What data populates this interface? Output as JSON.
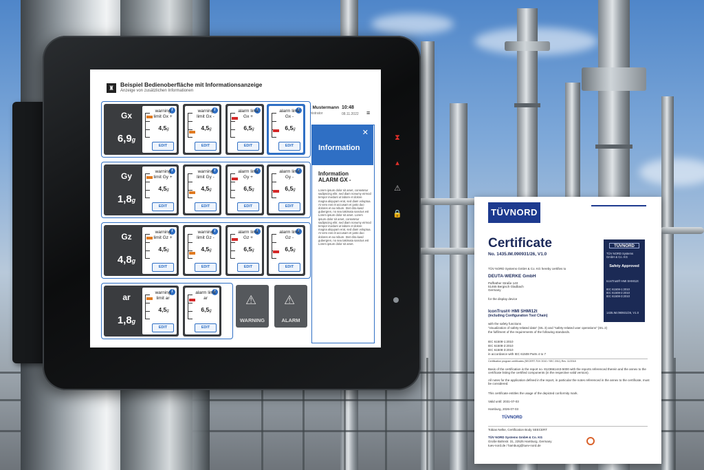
{
  "screen": {
    "header": {
      "logo_glyph": "♜",
      "title": "Beispiel Bedienoberfläche mit Informationsanzeige",
      "subtitle": "Anzeige von zusätzlichen Informationen",
      "user_name": "Max Mustermann",
      "user_role": "Administrator",
      "time": "10:48",
      "date": "08.11.2022",
      "menu_glyph": "≡",
      "user_glyph": "👤"
    },
    "rows": [
      {
        "axis": "Gx",
        "value": "6,9",
        "unit": "g",
        "tiles": [
          {
            "label": "warning limit Gx +",
            "value": "4,5",
            "unit": "g",
            "edit": "EDIT",
            "active": false
          },
          {
            "label": "warning limit Gx -",
            "value": "4,5",
            "unit": "g",
            "edit": "EDIT",
            "active": false
          },
          {
            "label": "alarm limit Gx +",
            "value": "6,5",
            "unit": "g",
            "edit": "EDIT",
            "active": false
          },
          {
            "label": "alarm limit Gx -",
            "value": "6,5",
            "unit": "g",
            "edit": "EDIT",
            "active": true
          }
        ]
      },
      {
        "axis": "Gy",
        "value": "1,8",
        "unit": "g",
        "tiles": [
          {
            "label": "warning limit Gy +",
            "value": "4,5",
            "unit": "g",
            "edit": "EDIT",
            "active": false
          },
          {
            "label": "warning limit Gy -",
            "value": "4,5",
            "unit": "g",
            "edit": "EDIT",
            "active": false
          },
          {
            "label": "alarm limit Gy +",
            "value": "6,5",
            "unit": "g",
            "edit": "EDIT",
            "active": false
          },
          {
            "label": "alarm limit Gy -",
            "value": "6,5",
            "unit": "g",
            "edit": "EDIT",
            "active": false
          }
        ]
      },
      {
        "axis": "Gz",
        "value": "4,8",
        "unit": "g",
        "tiles": [
          {
            "label": "warning limit Gz +",
            "value": "4,5",
            "unit": "g",
            "edit": "EDIT",
            "active": false
          },
          {
            "label": "warning limit Gz -",
            "value": "4,5",
            "unit": "g",
            "edit": "EDIT",
            "active": false
          },
          {
            "label": "alarm limit Gz +",
            "value": "6,5",
            "unit": "g",
            "edit": "EDIT",
            "active": false
          },
          {
            "label": "alarm limit Gz -",
            "value": "6,5",
            "unit": "g",
            "edit": "EDIT",
            "active": false
          }
        ]
      },
      {
        "axis": "ar",
        "value": "1,8",
        "unit": "g",
        "tiles": [
          {
            "label": "warning limit ar",
            "value": "4,5",
            "unit": "g",
            "edit": "EDIT",
            "active": false
          },
          {
            "label": "alarm limit ar",
            "value": "6,5",
            "unit": "g",
            "edit": "EDIT",
            "active": false
          }
        ]
      }
    ],
    "status": {
      "warning": "WARNING",
      "alarm": "ALARM",
      "glyph": "⚠"
    },
    "info_panel": {
      "title": "Information",
      "close_glyph": "✕",
      "subtitle_line1": "Information",
      "subtitle_line2": "ALARM GX -",
      "body": "Lorem ipsum dolor sit amet, consetetur sadipscing elitr, sed diam nonumy eirmod tempor invidunt ut labore et dolore magna aliquyam erat, sed diam voluptua. At vero eos et accusam et justo duo dolores et ea rebum. Stet clita kasd gubergren, no sea takimata sanctus est Lorem ipsum dolor sit amet. Lorem ipsum dolor sit amet, consetetur sadipscing elitr, sed diam nonumy eirmod tempor invidunt ut labore et dolore magna aliquyam erat, sed diam voluptua. At vero eos et accusam et justo duo dolores et ea rebum. Stet clita kasd gubergren, no sea takimata sanctus est Lorem ipsum dolor sit amet."
    }
  },
  "tablet_side_icons": [
    {
      "glyph": "⧗",
      "color": "#e0302a"
    },
    {
      "glyph": "▴",
      "color": "#e0302a"
    },
    {
      "glyph": "⚠",
      "color": "#bbbbbb"
    },
    {
      "glyph": "🔒",
      "color": "#f3c413"
    }
  ],
  "certificate": {
    "logo": "TÜVNORD",
    "title": "Certificate",
    "number": "No. 1435.IM.090931/26, V1.0",
    "intro": "TÜV NORD Systems GmbH & Co. KG hereby certifies to",
    "company": "DEUTA-WERKE GmbH",
    "address": [
      "Paffrather Straße 140",
      "51465 Bergisch Gladbach",
      "Germany"
    ],
    "for_device": "for the display device",
    "product": "IconTrust® HMI SHMI12t",
    "product_sub": "(including Configuration Tool Chain)",
    "functions_intro": "with the safety functions",
    "functions": "\"visualization of safety-related data\" (SIL 3) and \"safety-related user operations\" (SIL 2)",
    "fulfillment": "the fulfilment of the requirements of the following standards.",
    "standards": [
      "IEC 61508-1:2010",
      "IEC 61508-2:2010",
      "IEC 61508-3:2010",
      "in accordance with IEC 61508 Parts 4 to 7"
    ],
    "program": "Certification program certificates (SECERT-TÜV 2010 / SEC 2011) Rev. 11/2018",
    "basis": "Basis of the certification is the report no. 8123661443-5000 with the reports referenced therein and the annex to the certificate listing the certified components (in the respective valid version).",
    "notes": "All notes for the application defined in the report, in particular the notes referenced in the annex to the certificate, must be considered.",
    "mark": "This certificate entitles the usage of the depicted conformity mark.",
    "valid": "Valid until: 2031-07-03",
    "place_date": "Hamburg, 2026-07-03",
    "signer": "Tobias Nelke, Certification Body SEECERT",
    "issuer": "TÜV NORD Systems GmbH & Co. KG",
    "issuer_address": "Große Bahnstr. 31, 22525 Hamburg, Germany",
    "issuer_web": "tuev-nord.de / hamburg@tuev-nord.de",
    "seal": {
      "logo": "TÜVNORD",
      "top_lines": [
        "TÜV NORD Systems",
        "GmbH & Co. KG"
      ],
      "approved": "Safety Approved",
      "product": "IconTrust® HMI SHMI12t",
      "standards": [
        "IEC 61508-1:2010",
        "IEC 61508-2:2010",
        "IEC 61508-3:2010"
      ],
      "number": "1435.IM.090931/26, V1.0"
    }
  }
}
